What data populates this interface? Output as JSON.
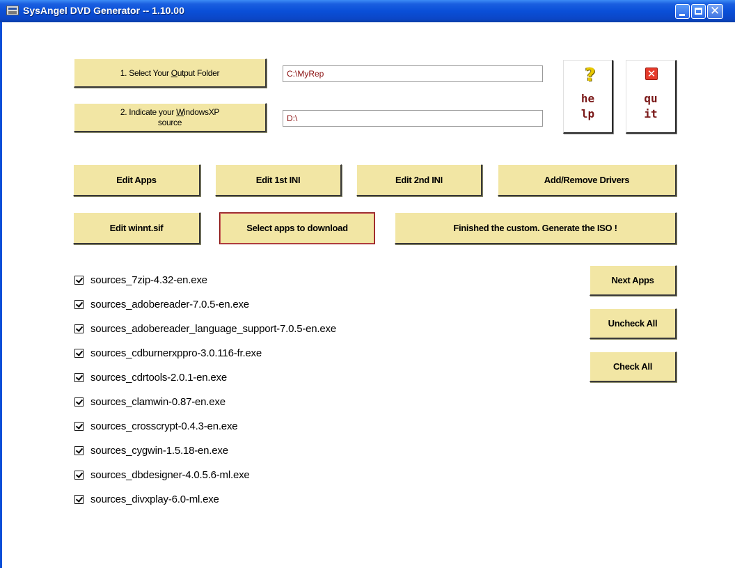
{
  "window": {
    "title": "SysAngel DVD Generator -- 1.10.00",
    "controls": {
      "minimize_icon": "minimize-icon",
      "maximize_icon": "maximize-icon",
      "close_icon": "close-icon"
    }
  },
  "setup": {
    "output_button": {
      "pre": "1. Select Your ",
      "underlined": "O",
      "post": "utput Folder"
    },
    "output_path": "C:\\MyRep",
    "source_button": {
      "pre": "2. Indicate your ",
      "underlined": "W",
      "post": "indowsXP",
      "line2": "source"
    },
    "source_path": "D:\\"
  },
  "side_buttons": {
    "help": {
      "line1": "he",
      "line2": "lp",
      "icon": "help-question-icon"
    },
    "quit": {
      "line1": "qu",
      "line2": "it",
      "icon": "quit-x-icon"
    }
  },
  "toolbar_row1": {
    "edit_apps": "Edit Apps",
    "edit_1st_ini": "Edit 1st INI",
    "edit_2nd_ini": "Edit 2nd INI",
    "add_remove_drivers": "Add/Remove Drivers"
  },
  "toolbar_row2": {
    "edit_winnt": "Edit winnt.sif",
    "select_apps": "Select apps to download",
    "generate_iso": "Finished the custom. Generate the ISO !"
  },
  "list_actions": {
    "next_apps": "Next Apps",
    "uncheck_all": "Uncheck All",
    "check_all": "Check All"
  },
  "apps": [
    {
      "label": "sources_7zip-4.32-en.exe",
      "checked": true
    },
    {
      "label": "sources_adobereader-7.0.5-en.exe",
      "checked": true
    },
    {
      "label": "sources_adobereader_language_support-7.0.5-en.exe",
      "checked": true
    },
    {
      "label": "sources_cdburnerxppro-3.0.116-fr.exe",
      "checked": true
    },
    {
      "label": "sources_cdrtools-2.0.1-en.exe",
      "checked": true
    },
    {
      "label": "sources_clamwin-0.87-en.exe",
      "checked": true
    },
    {
      "label": "sources_crosscrypt-0.4.3-en.exe",
      "checked": true
    },
    {
      "label": "sources_cygwin-1.5.18-en.exe",
      "checked": true
    },
    {
      "label": "sources_dbdesigner-4.0.5.6-ml.exe",
      "checked": true
    },
    {
      "label": "sources_divxplay-6.0-ml.exe",
      "checked": true
    }
  ],
  "colors": {
    "button_face": "#f2e6a4",
    "titlebar": "#0a4fd8",
    "path_text": "#8a1010"
  }
}
